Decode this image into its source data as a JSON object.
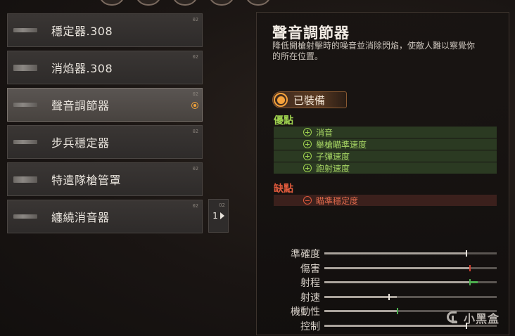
{
  "attachments": {
    "items": [
      {
        "label": "穩定器.308",
        "tag": "02",
        "selected": false,
        "thick": false
      },
      {
        "label": "消焰器.308",
        "tag": "02",
        "selected": false,
        "thick": true
      },
      {
        "label": "聲音調節器",
        "tag": "02",
        "selected": true,
        "thick": false
      },
      {
        "label": "步兵穩定器",
        "tag": "02",
        "selected": false,
        "thick": false
      },
      {
        "label": "特遣隊槍管罩",
        "tag": "02",
        "selected": false,
        "thick": true
      },
      {
        "label": "纏繞消音器",
        "tag": "02",
        "selected": false,
        "thick": false
      }
    ],
    "pager": {
      "page": "1",
      "tag": "02"
    }
  },
  "detail": {
    "title": "聲音調節器",
    "description": "降低開槍射擊時的噪音並消除閃焰，使敵人難以察覺你的所在位置。",
    "equipped_label": "已裝備",
    "pros_title": "優點",
    "pros": [
      "消音",
      "舉槍瞄準速度",
      "子彈速度",
      "跑射速度"
    ],
    "cons_title": "缺點",
    "cons": [
      "瞄準穩定度"
    ]
  },
  "stats": [
    {
      "name": "準確度",
      "value": 0.82,
      "delta": 0.0,
      "delta_color": "#aaa39c"
    },
    {
      "name": "傷害",
      "value": 0.84,
      "delta": 0.0,
      "delta_color": "#d04030"
    },
    {
      "name": "射程",
      "value": 0.84,
      "delta": 0.05,
      "delta_color": "#4caf4f"
    },
    {
      "name": "射速",
      "value": 0.37,
      "delta": 0.05,
      "delta_color": "#aaa39c"
    },
    {
      "name": "機動性",
      "value": 0.42,
      "delta": 0.0,
      "delta_color": "#4caf4f"
    },
    {
      "name": "控制",
      "value": 0.82,
      "delta": 0.0,
      "delta_color": "#aaa39c"
    }
  ],
  "watermark": {
    "text": "小黑盒"
  },
  "colors": {
    "accent": "#f5a23c",
    "pro": "#9fd24f",
    "con": "#e05a3c"
  }
}
